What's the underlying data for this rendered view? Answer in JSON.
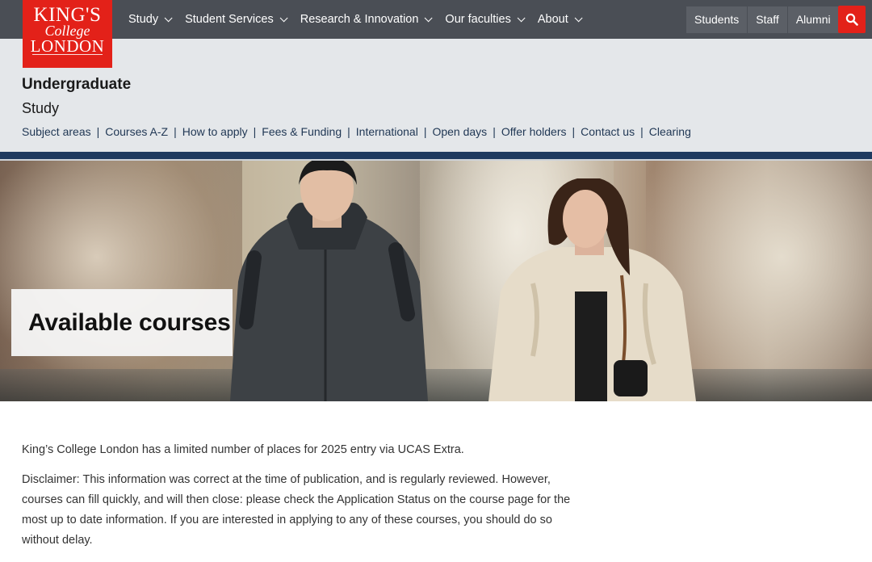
{
  "logo": {
    "line1": "KING'S",
    "line2": "College",
    "line3": "LONDON"
  },
  "nav": {
    "items": [
      {
        "label": "Study"
      },
      {
        "label": "Student Services"
      },
      {
        "label": "Research & Innovation"
      },
      {
        "label": "Our faculties"
      },
      {
        "label": "About"
      }
    ],
    "audience": [
      {
        "label": "Students"
      },
      {
        "label": "Staff"
      },
      {
        "label": "Alumni"
      }
    ],
    "search_icon": "search-icon"
  },
  "section": {
    "title": "Undergraduate",
    "subtitle": "Study",
    "links": [
      {
        "label": "Subject areas"
      },
      {
        "label": "Courses A-Z"
      },
      {
        "label": "How to apply"
      },
      {
        "label": "Fees & Funding"
      },
      {
        "label": "International"
      },
      {
        "label": "Open days"
      },
      {
        "label": "Offer holders"
      },
      {
        "label": "Contact us"
      },
      {
        "label": "Clearing"
      }
    ],
    "separator": "|"
  },
  "hero": {
    "heading": "Available courses"
  },
  "content": {
    "para1": "King’s College London has a limited number of places for 2025 entry via UCAS Extra.",
    "para2": "Disclaimer: This information was correct at the time of publication, and is regularly reviewed. However, courses can fill quickly, and will then close: please check the Application Status on the course page for the most up to date information. If you are interested in applying to any of these courses, you should do so without delay."
  },
  "colors": {
    "brand_red": "#e32119",
    "topbar": "#4a4e55",
    "subhead_bg": "#e4e7ea",
    "navy": "#1f3a5f",
    "link": "#213855"
  }
}
